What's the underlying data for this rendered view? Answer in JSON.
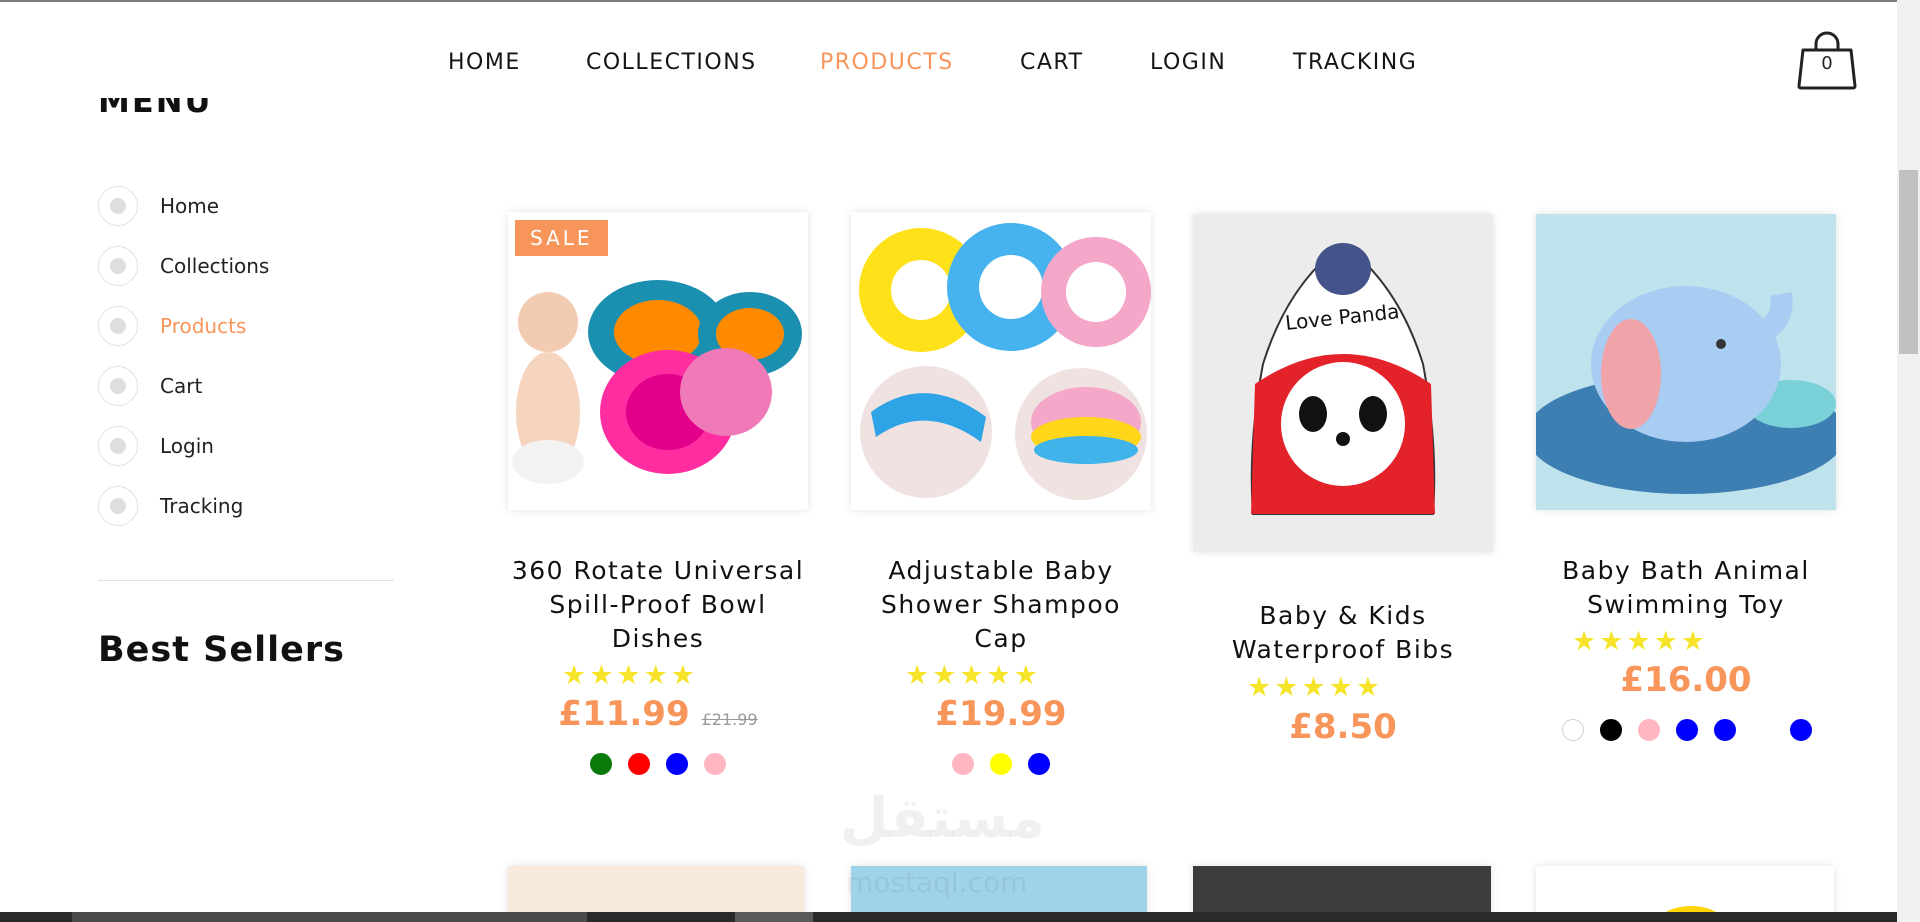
{
  "nav": {
    "items": [
      {
        "label": "HOME",
        "active": false
      },
      {
        "label": "COLLECTIONS",
        "active": false
      },
      {
        "label": "PRODUCTS",
        "active": true
      },
      {
        "label": "CART",
        "active": false
      },
      {
        "label": "LOGIN",
        "active": false
      },
      {
        "label": "TRACKING",
        "active": false
      }
    ],
    "cart_count": "0"
  },
  "sidebar": {
    "menu_heading": "MENU",
    "items": [
      {
        "label": "Home"
      },
      {
        "label": "Collections"
      },
      {
        "label": "Products",
        "active": true
      },
      {
        "label": "Cart"
      },
      {
        "label": "Login"
      },
      {
        "label": "Tracking"
      }
    ],
    "best_sellers": "Best Sellers"
  },
  "products": [
    {
      "badge": "SALE",
      "title": "360 Rotate Universal Spill-Proof Bowl Dishes",
      "stars": "★★★★★",
      "price": "£11.99",
      "old_price": "£21.99",
      "swatches": [
        "#0a7a0a",
        "#ff0000",
        "#0000ff",
        "#ffb6c1"
      ]
    },
    {
      "title": "Adjustable Baby Shower Shampoo Cap",
      "stars": "★★★★★",
      "price": "£19.99",
      "swatches": [
        "#ffb6c1",
        "#ffff00",
        "#0000ff"
      ]
    },
    {
      "title": "Baby & Kids Waterproof Bibs",
      "stars": "★★★★★",
      "price": "£8.50",
      "swatches": []
    },
    {
      "title": "Baby Bath Animal Swimming Toy",
      "stars": "★★★★★",
      "price": "£16.00",
      "swatches": [
        "#ffffff",
        "#000000",
        "#ffb6c1",
        "#0000ff",
        "#0000ff",
        "#0000ff"
      ]
    }
  ],
  "watermark": {
    "text": "مستقل",
    "sub": "mostaql.com"
  },
  "colors": {
    "accent": "#f7955b",
    "star": "#f5e42a"
  }
}
